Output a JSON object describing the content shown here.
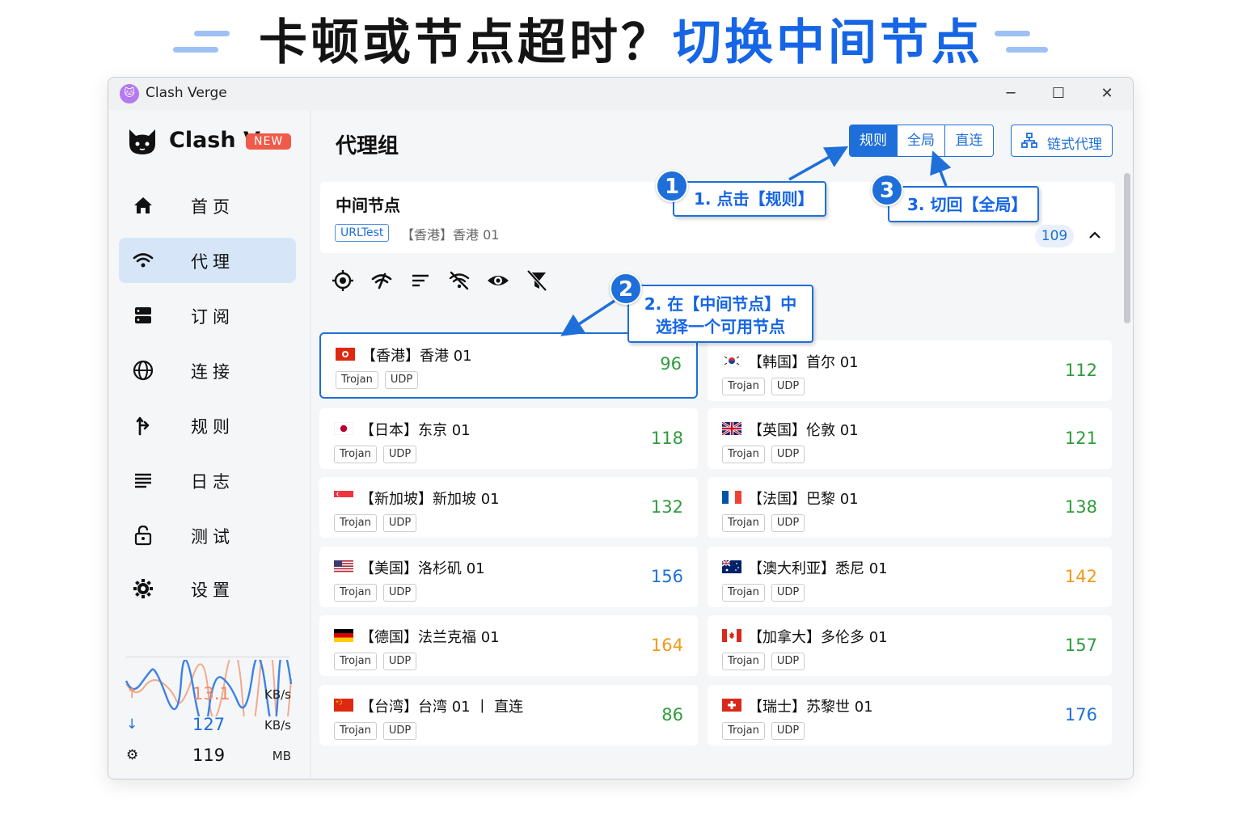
{
  "headline": {
    "part1": "卡顿或节点超时？",
    "part2": "切换中间节点"
  },
  "window": {
    "title": "Clash Verge",
    "controls": [
      "─",
      "☐",
      "✕"
    ]
  },
  "sidebar": {
    "logo_text": "Clash V",
    "new_badge": "NEW",
    "nav": [
      {
        "label": "首页",
        "icon": "home-icon"
      },
      {
        "label": "代理",
        "icon": "wifi-icon",
        "active": true
      },
      {
        "label": "订阅",
        "icon": "server-icon"
      },
      {
        "label": "连接",
        "icon": "globe-icon"
      },
      {
        "label": "规则",
        "icon": "fork-icon"
      },
      {
        "label": "日志",
        "icon": "list-icon"
      },
      {
        "label": "测试",
        "icon": "lock-icon"
      },
      {
        "label": "设置",
        "icon": "gear-icon"
      }
    ],
    "stats": {
      "upload": {
        "value": "13.1",
        "unit": "KB/s"
      },
      "download": {
        "value": "127",
        "unit": "KB/s"
      },
      "memory": {
        "value": "119",
        "unit": "MB"
      }
    }
  },
  "main": {
    "title": "代理组",
    "modes": [
      {
        "label": "规则",
        "active": true
      },
      {
        "label": "全局",
        "active": false
      },
      {
        "label": "直连",
        "active": false
      }
    ],
    "chain_label": "链式代理",
    "group": {
      "name": "中间节点",
      "type": "URLTest",
      "current": "【香港】香港 01",
      "count": "109"
    },
    "nodes": [
      {
        "name": "【香港】香港 01",
        "flag": "hk",
        "tags": [
          "Trojan",
          "UDP"
        ],
        "delay": "96",
        "color": "green",
        "selected": true
      },
      {
        "name": "【韩国】首尔 01",
        "flag": "kr",
        "tags": [
          "Trojan",
          "UDP"
        ],
        "delay": "112",
        "color": "green"
      },
      {
        "name": "【日本】东京 01",
        "flag": "jp",
        "tags": [
          "Trojan",
          "UDP"
        ],
        "delay": "118",
        "color": "green"
      },
      {
        "name": "【英国】伦敦 01",
        "flag": "gb",
        "tags": [
          "Trojan",
          "UDP"
        ],
        "delay": "121",
        "color": "green"
      },
      {
        "name": "【新加坡】新加坡 01",
        "flag": "sg",
        "tags": [
          "Trojan",
          "UDP"
        ],
        "delay": "132",
        "color": "green"
      },
      {
        "name": "【法国】巴黎 01",
        "flag": "fr",
        "tags": [
          "Trojan",
          "UDP"
        ],
        "delay": "138",
        "color": "green"
      },
      {
        "name": "【美国】洛杉矶 01",
        "flag": "us",
        "tags": [
          "Trojan",
          "UDP"
        ],
        "delay": "156",
        "color": "blue"
      },
      {
        "name": "【澳大利亚】悉尼 01",
        "flag": "au",
        "tags": [
          "Trojan",
          "UDP"
        ],
        "delay": "142",
        "color": "orange"
      },
      {
        "name": "【德国】法兰克福 01",
        "flag": "de",
        "tags": [
          "Trojan",
          "UDP"
        ],
        "delay": "164",
        "color": "orange"
      },
      {
        "name": "【加拿大】多伦多 01",
        "flag": "ca",
        "tags": [
          "Trojan",
          "UDP"
        ],
        "delay": "157",
        "color": "green"
      },
      {
        "name": "【台湾】台湾 01 丨 直连",
        "flag": "tw",
        "tags": [
          "Trojan",
          "UDP"
        ],
        "delay": "86",
        "color": "green"
      },
      {
        "name": "【瑞士】苏黎世 01",
        "flag": "ch",
        "tags": [
          "Trojan",
          "UDP"
        ],
        "delay": "176",
        "color": "blue"
      }
    ]
  },
  "annotations": {
    "step1": {
      "num": "1",
      "text": "1. 点击【规则】"
    },
    "step2": {
      "num": "2",
      "line1": "2. 在【中间节点】中",
      "line2": "选择一个可用节点"
    },
    "step3": {
      "num": "3",
      "text": "3. 切回【全局】"
    }
  },
  "colors": {
    "accent": "#1e6fd9",
    "headline_blue": "#1565e6",
    "active_nav": "#d6e6f8",
    "green": "#2e9c3c",
    "orange": "#f09a18",
    "badge_red": "#f05a4a"
  }
}
